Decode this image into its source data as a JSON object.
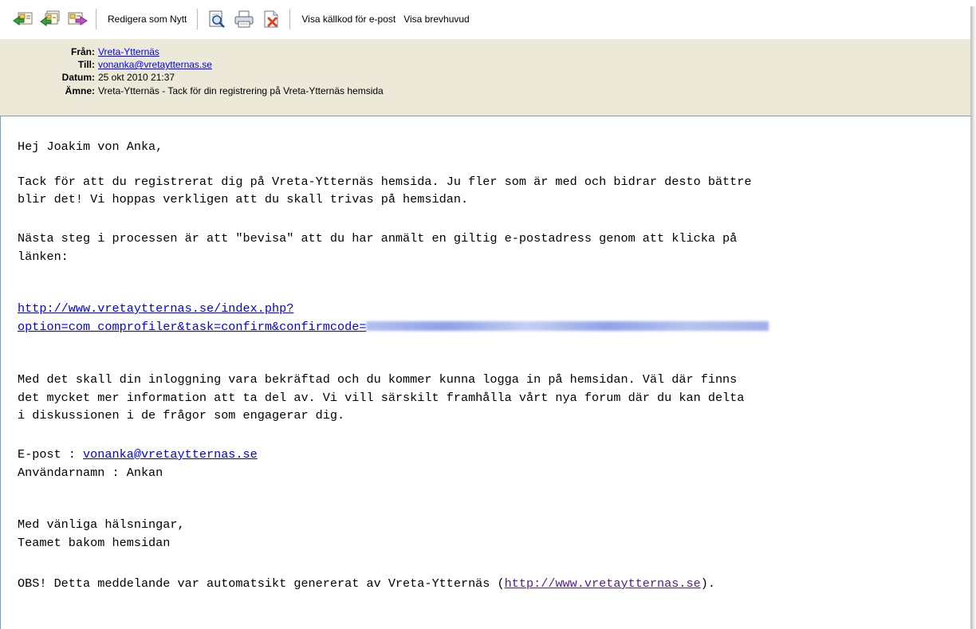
{
  "toolbar": {
    "icons": [
      "reply-icon",
      "reply-all-icon",
      "forward-icon"
    ],
    "edit_as_new_label": "Redigera som Nytt",
    "tool_icons": [
      "preview-icon",
      "print-icon",
      "delete-icon"
    ],
    "view_source_label": "Visa källkod för e-post",
    "view_headers_label": "Visa brevhuvud"
  },
  "header": {
    "from_label": "Från:",
    "from_value": "Vreta-Ytternäs",
    "to_label": "Till:",
    "to_value": "vonanka@vretaytternas.se",
    "date_label": "Datum:",
    "date_value": "25 okt 2010 21:37",
    "subject_label": "Ämne:",
    "subject_value": "Vreta-Ytternäs - Tack för din registrering på Vreta-Ytternäs hemsida"
  },
  "body": {
    "greeting": "Hej Joakim von Anka,",
    "p1_line1": "Tack för att du registrerat dig på Vreta-Ytternäs hemsida. Ju fler som är med och bidrar desto bättre",
    "p1_line2": "blir det! Vi hoppas verkligen att du skall trivas på hemsidan.",
    "p2_line1": "Nästa steg i processen är att \"bevisa\" att du har anmält en giltig e-postadress genom att klicka på",
    "p2_line2": "länken:",
    "confirm_link_line1": "http://www.vretaytternas.se/index.php?",
    "confirm_link_line2": "option=com_comprofiler&task=confirm&confirmcode=",
    "p3_line1": "Med det skall din inloggning vara bekräftad och du kommer kunna logga in på hemsidan. Väl där finns",
    "p3_line2": "det mycket mer information att ta del av. Vi vill särskilt framhålla vårt nya forum där du kan delta",
    "p3_line3": "i diskussionen i de frågor som engagerar dig.",
    "email_label": "E-post : ",
    "email_value": "vonanka@vretaytternas.se",
    "username_line": "Användarnamn : Ankan",
    "closing1": "Med vänliga hälsningar,",
    "closing2": "Teamet bakom hemsidan",
    "obs_prefix": "OBS! Detta meddelande var automatsikt genererat av Vreta-Ytternäs (",
    "obs_link": "http://www.vretaytternas.se",
    "obs_suffix": ")."
  }
}
